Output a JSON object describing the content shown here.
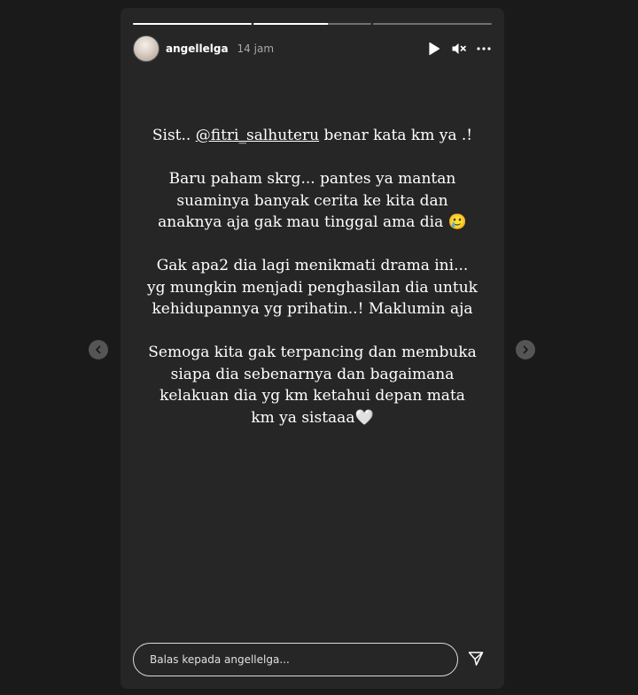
{
  "story": {
    "username": "angellelga",
    "time": "14 jam",
    "progress": [
      1.0,
      0.63,
      0.0
    ],
    "caption": {
      "p1_before": "Sist.. ",
      "p1_mention": "@fitri_salhuteru",
      "p1_after": " benar kata km ya .!",
      "p2": "Baru paham skrg... pantes ya mantan suaminya banyak cerita ke kita dan anaknya aja gak mau tinggal ama dia 🥲",
      "p3": "Gak apa2 dia lagi menikmati drama ini... yg mungkin menjadi penghasilan dia untuk kehidupannya yg prihatin..! Maklumin aja",
      "p4": "Semoga kita gak terpancing dan membuka siapa dia sebenarnya dan bagaimana kelakuan dia yg km ketahui depan mata km ya sistaaa🤍"
    },
    "reply_placeholder": "Balas kepada angellelga..."
  },
  "icons": {
    "play": "play-icon",
    "mute": "speaker-muted-icon",
    "more": "more-options-icon",
    "send": "send-icon",
    "prev": "chevron-left-icon",
    "next": "chevron-right-icon"
  },
  "colors": {
    "background": "#1a1a1a",
    "story_bg": "#262626",
    "text": "#ffffff",
    "muted_text": "#a8a8a8"
  }
}
